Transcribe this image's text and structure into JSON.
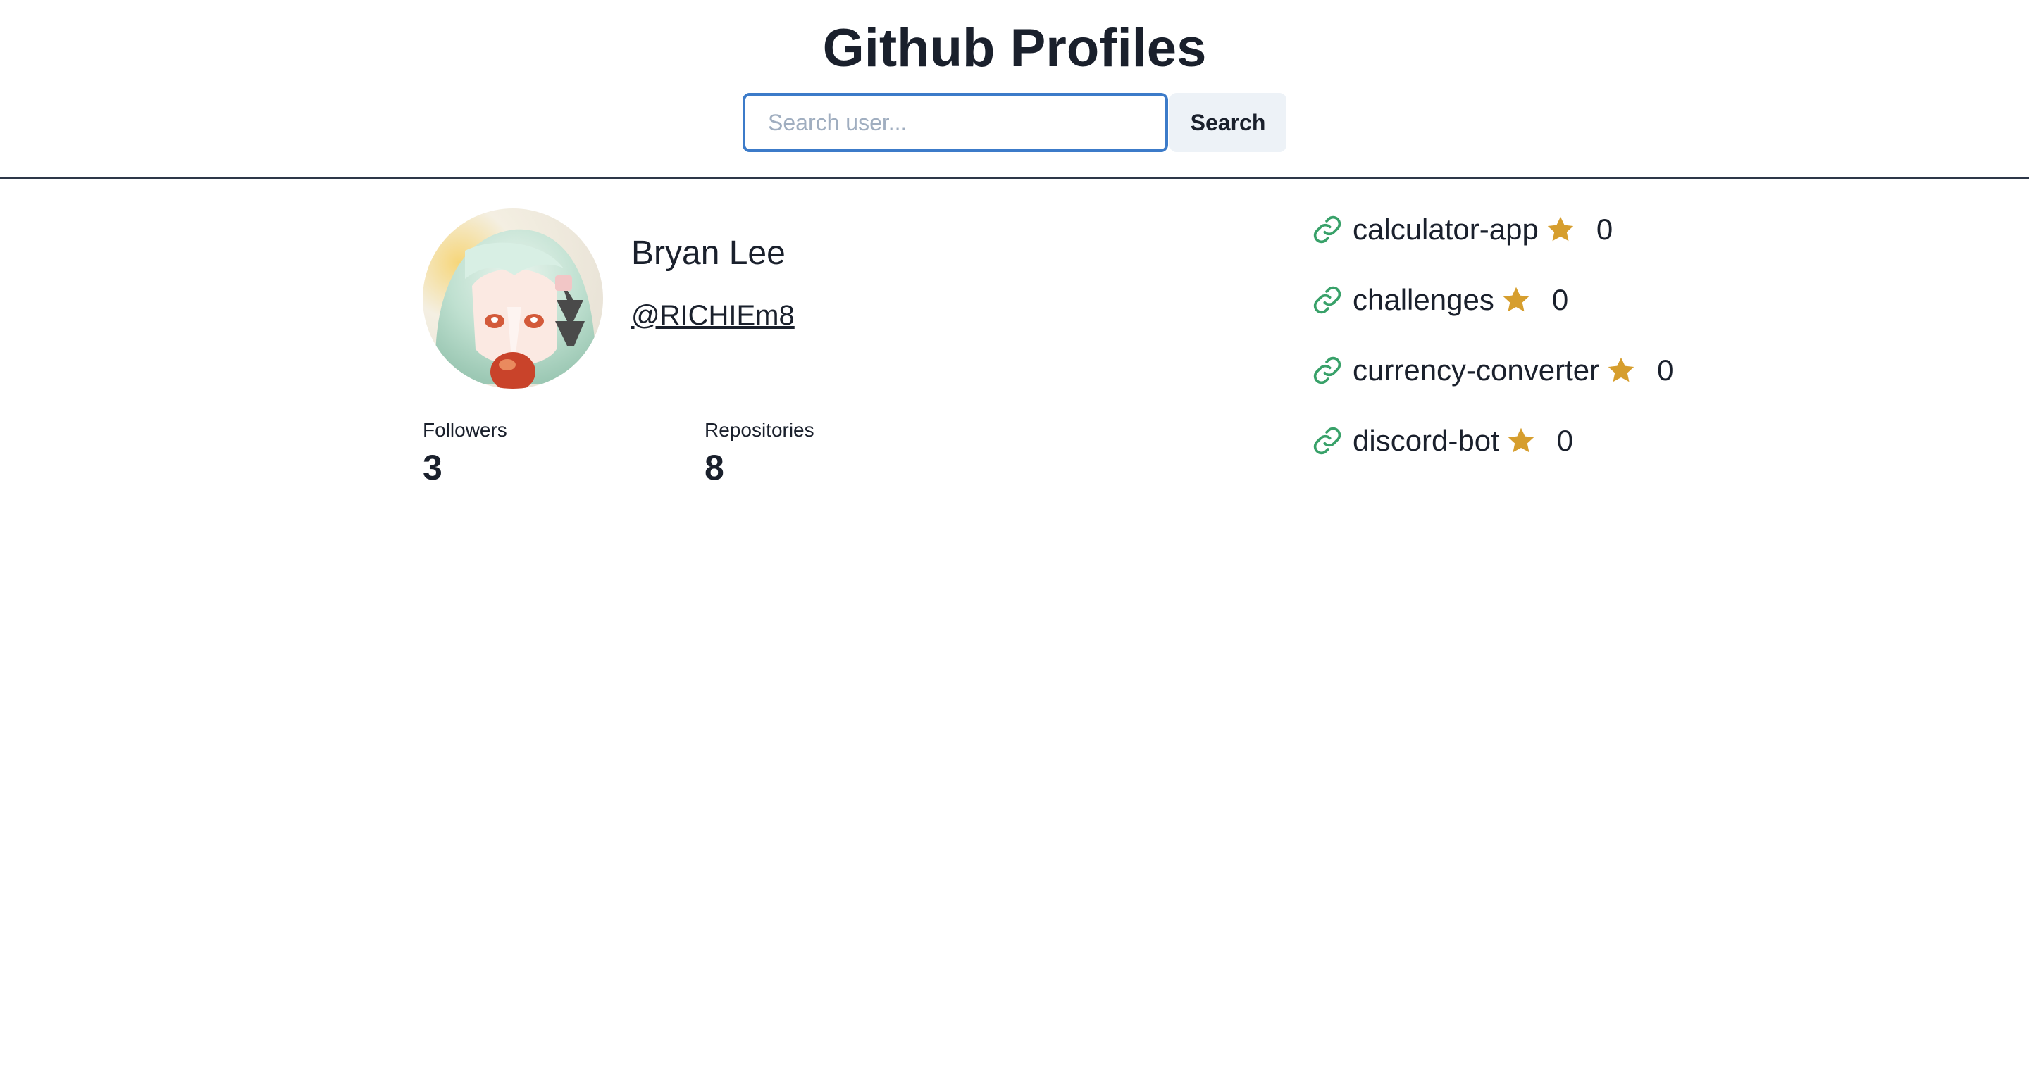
{
  "header": {
    "title": "Github Profiles",
    "search_placeholder": "Search user...",
    "search_value": "",
    "search_button_label": "Search"
  },
  "profile": {
    "name": "Bryan Lee",
    "handle": "@RICHIEm8",
    "avatar_icon": "user-avatar-image",
    "stats": {
      "followers_label": "Followers",
      "followers_value": "3",
      "repositories_label": "Repositories",
      "repositories_value": "8"
    }
  },
  "repos": [
    {
      "name": "calculator-app",
      "stars": "0"
    },
    {
      "name": "challenges",
      "stars": "0"
    },
    {
      "name": "currency-converter",
      "stars": "0"
    },
    {
      "name": "discord-bot",
      "stars": "0"
    }
  ],
  "icons": {
    "link": "link-icon",
    "star": "star-icon"
  },
  "colors": {
    "input_focus_border": "#3c7bc9",
    "button_bg": "#edf2f7",
    "link_icon": "#38a169",
    "star_icon": "#d69e2e",
    "text": "#1a202c",
    "divider": "#2d3748"
  }
}
